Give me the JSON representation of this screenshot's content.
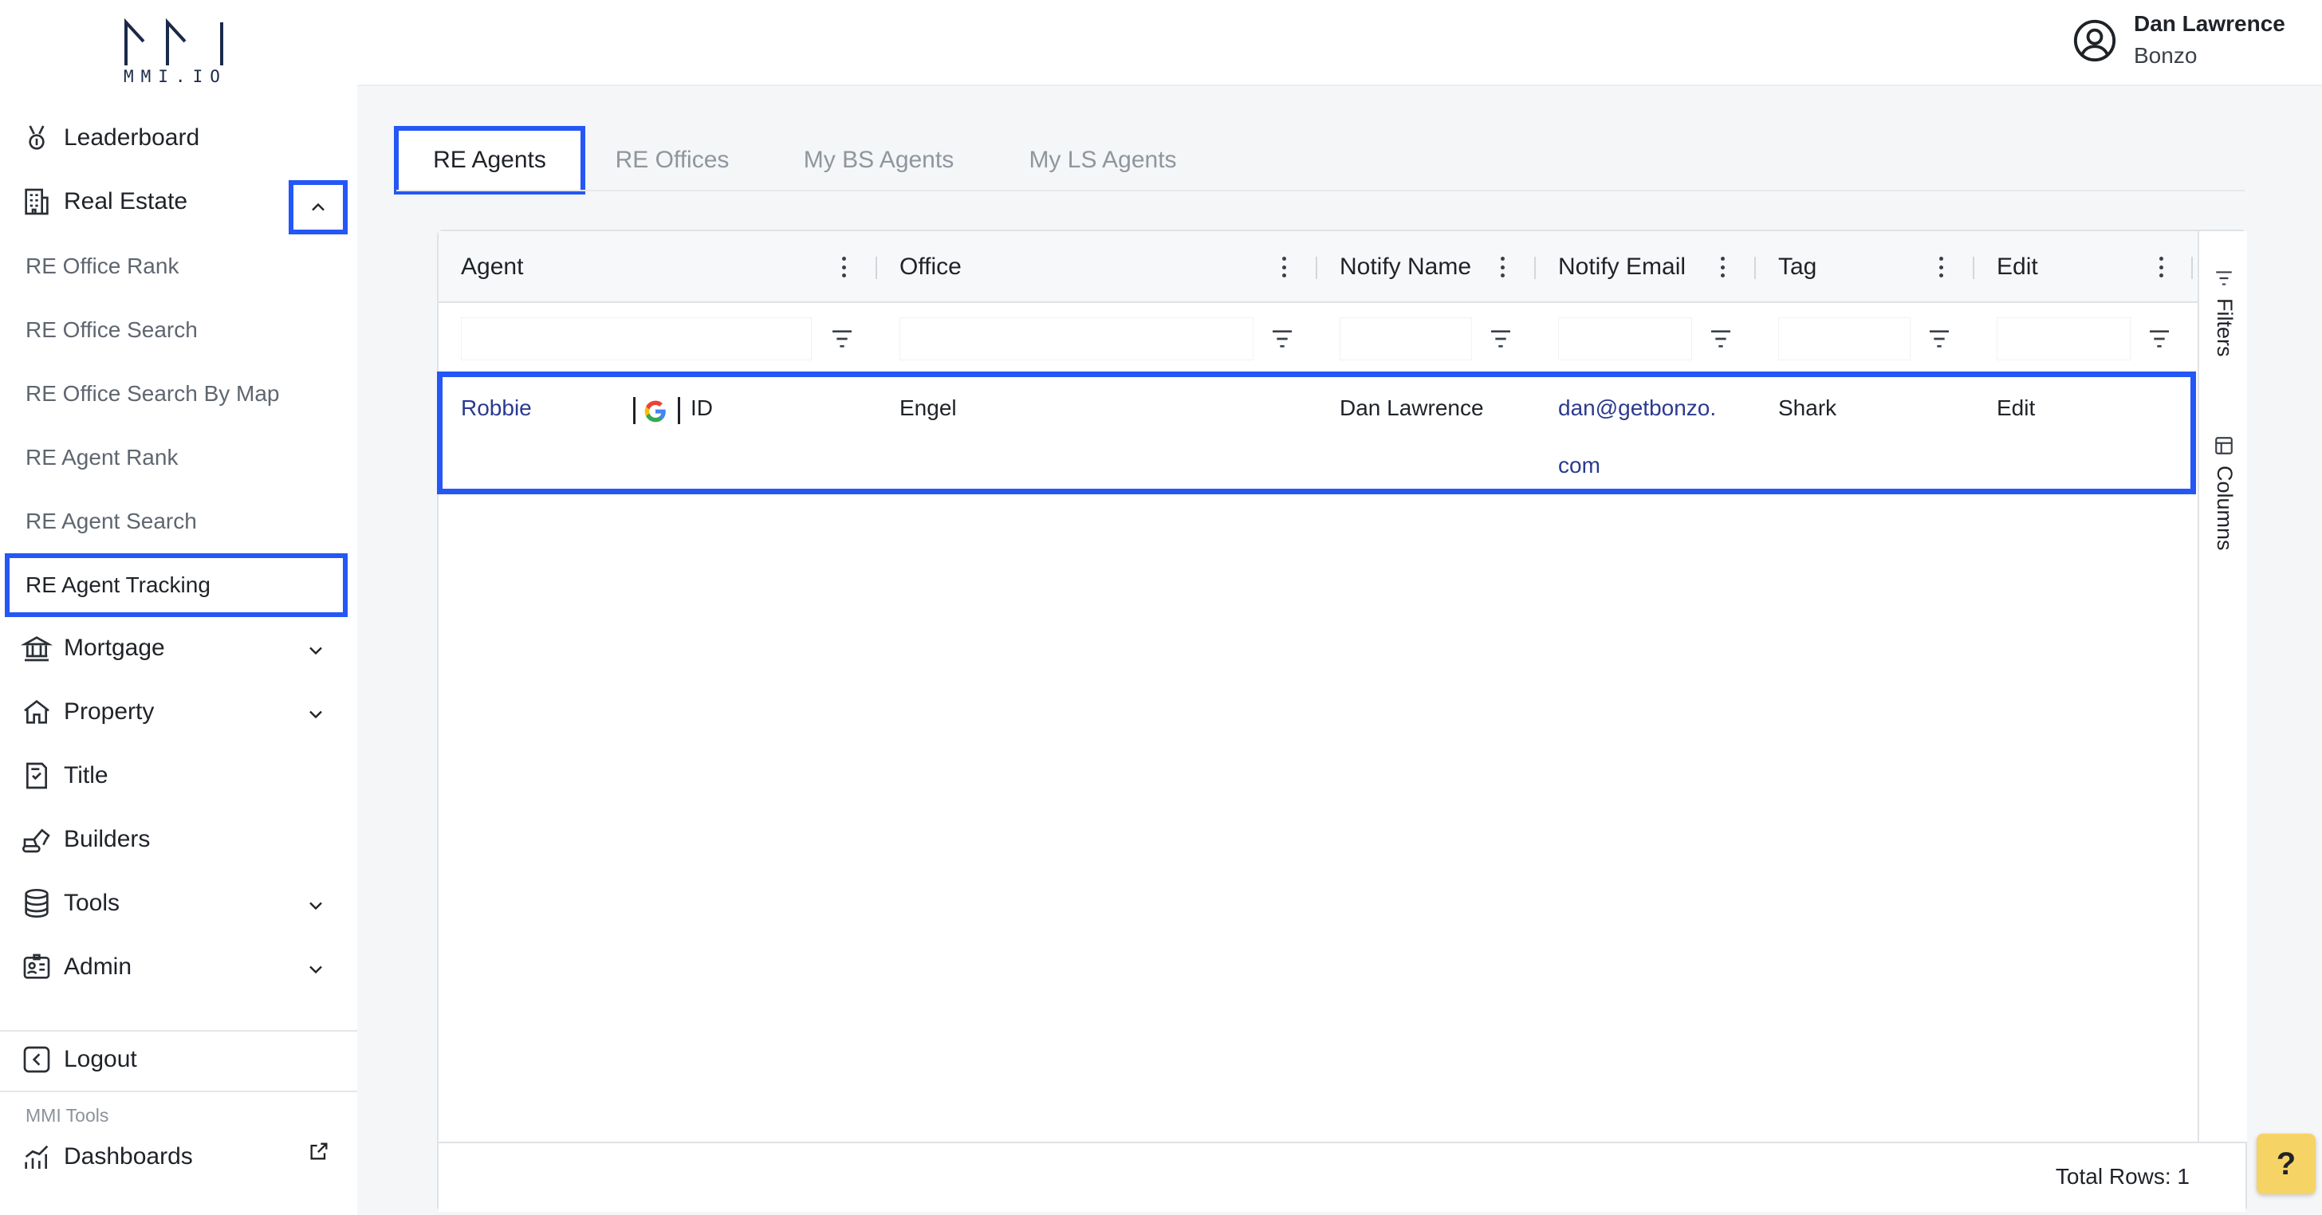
{
  "brand": {
    "logo_text": "MMI.IO"
  },
  "user": {
    "name": "Dan Lawrence",
    "org": "Bonzo"
  },
  "sidebar": {
    "items": [
      {
        "label": "Leaderboard",
        "icon": "medal-icon"
      },
      {
        "label": "Real Estate",
        "icon": "building-icon",
        "expanded": true
      },
      {
        "label": "Mortgage",
        "icon": "bank-icon"
      },
      {
        "label": "Property",
        "icon": "home-icon"
      },
      {
        "label": "Title",
        "icon": "certificate-icon"
      },
      {
        "label": "Builders",
        "icon": "excavator-icon"
      },
      {
        "label": "Tools",
        "icon": "database-icon"
      },
      {
        "label": "Admin",
        "icon": "id-card-icon"
      }
    ],
    "real_estate_sub": [
      "RE Office Rank",
      "RE Office Search",
      "RE Office Search By Map",
      "RE Agent Rank",
      "RE Agent Search",
      "RE Agent Tracking"
    ],
    "logout": "Logout",
    "tools_section": "MMI Tools",
    "dashboards": "Dashboards"
  },
  "tabs": [
    {
      "label": "RE Agents",
      "active": true
    },
    {
      "label": "RE Offices",
      "active": false
    },
    {
      "label": "My BS Agents",
      "active": false
    },
    {
      "label": "My LS Agents",
      "active": false
    }
  ],
  "grid": {
    "columns": [
      "Agent",
      "Office",
      "Notify Name",
      "Notify Email",
      "Tag",
      "Edit"
    ],
    "rows": [
      {
        "agent": "Robbie",
        "agent_id_label": "ID",
        "office": "Engel",
        "notify_name": "Dan Lawrence",
        "notify_email_line1": "dan@getbonzo.",
        "notify_email_line2": "com",
        "tag": "Shark",
        "edit": "Edit"
      }
    ],
    "side_tools": {
      "filters": "Filters",
      "columns": "Columns"
    },
    "total_rows": "Total Rows: 1"
  },
  "help": "?",
  "colors": {
    "highlight": "#2457f5",
    "link": "#2b3a8f",
    "help_bg": "#f6d365"
  }
}
